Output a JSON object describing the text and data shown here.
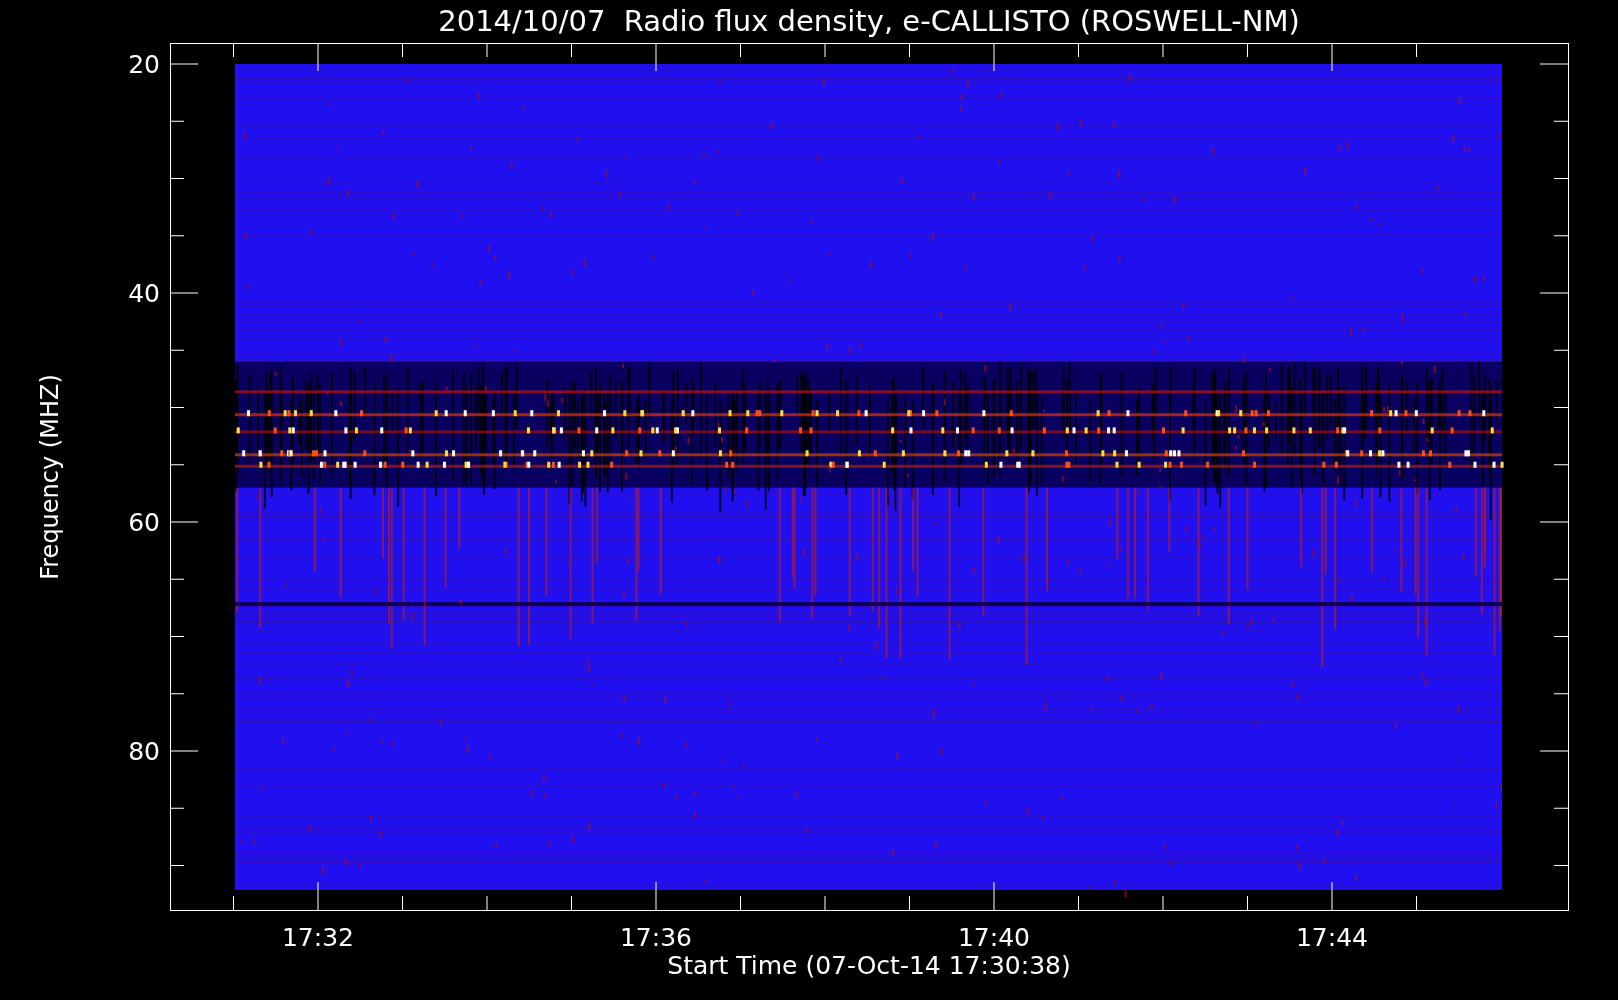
{
  "title": "2014/10/07  Radio flux density, e-CALLISTO (ROSWELL-NM)",
  "y_axis": {
    "label": "Frequency (MHZ)",
    "ticks": [
      "20",
      "40",
      "60",
      "80"
    ]
  },
  "x_axis": {
    "label": "Start Time (07-Oct-14 17:30:38)",
    "ticks": [
      "17:32",
      "17:36",
      "17:40",
      "17:44"
    ]
  }
}
